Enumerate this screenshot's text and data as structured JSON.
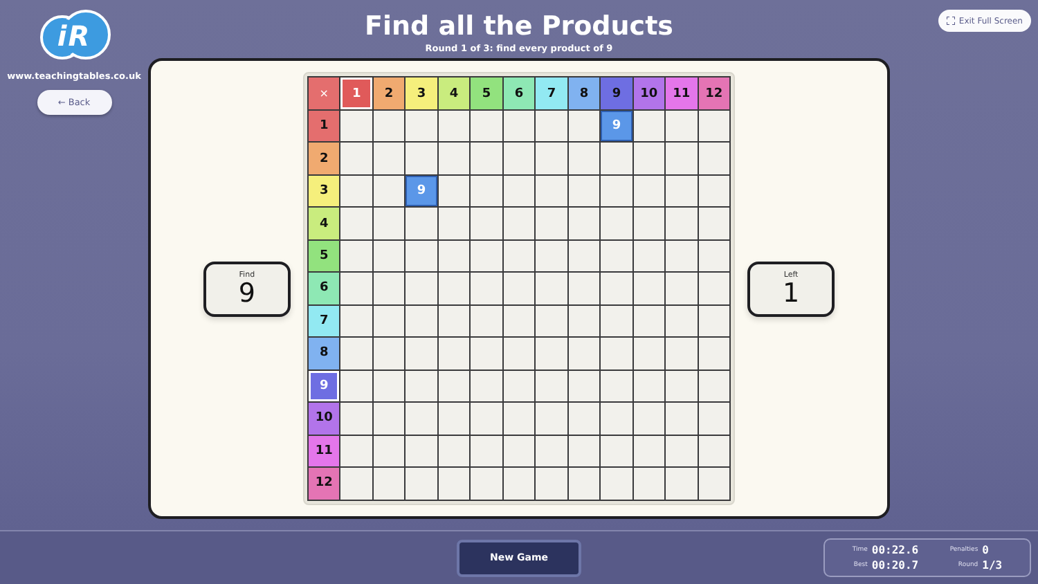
{
  "logo": {
    "text": "iR",
    "site": "www.teachingtables.co.uk"
  },
  "back_button": "← Back",
  "title": "Find all the Products",
  "subtitle": "Round 1 of 3: find every product of 9",
  "exit_button": "Exit Full Screen",
  "find": {
    "label": "Find",
    "value": "9"
  },
  "left": {
    "label": "Left",
    "value": "1"
  },
  "grid": {
    "corner": "×",
    "columns": [
      {
        "label": "1",
        "color": "#e05a5a",
        "selected": true
      },
      {
        "label": "2",
        "color": "#f0aa70",
        "selected": false
      },
      {
        "label": "3",
        "color": "#f5ef7c",
        "selected": false
      },
      {
        "label": "4",
        "color": "#c9ec7e",
        "selected": false
      },
      {
        "label": "5",
        "color": "#92e27e",
        "selected": false
      },
      {
        "label": "6",
        "color": "#8ee8b4",
        "selected": false
      },
      {
        "label": "7",
        "color": "#92e9f2",
        "selected": false
      },
      {
        "label": "8",
        "color": "#80b2f0",
        "selected": false
      },
      {
        "label": "9",
        "color": "#6e6ee2",
        "selected": false
      },
      {
        "label": "10",
        "color": "#b274ea",
        "selected": false
      },
      {
        "label": "11",
        "color": "#e476ea",
        "selected": false
      },
      {
        "label": "12",
        "color": "#e474b4",
        "selected": false
      }
    ],
    "rows": [
      {
        "label": "1",
        "color": "#e46e6e",
        "selected": false,
        "cells": [
          {
            "found": false
          },
          {
            "found": false
          },
          {
            "found": false
          },
          {
            "found": false
          },
          {
            "found": false
          },
          {
            "found": false
          },
          {
            "found": false
          },
          {
            "found": false
          },
          {
            "found": true,
            "value": "9"
          },
          {
            "found": false
          },
          {
            "found": false
          },
          {
            "found": false
          }
        ]
      },
      {
        "label": "2",
        "color": "#f0aa70",
        "selected": false,
        "cells": [
          {
            "found": false
          },
          {
            "found": false
          },
          {
            "found": false
          },
          {
            "found": false
          },
          {
            "found": false
          },
          {
            "found": false
          },
          {
            "found": false
          },
          {
            "found": false
          },
          {
            "found": false
          },
          {
            "found": false
          },
          {
            "found": false
          },
          {
            "found": false
          }
        ]
      },
      {
        "label": "3",
        "color": "#f5ef7c",
        "selected": false,
        "cells": [
          {
            "found": false
          },
          {
            "found": false
          },
          {
            "found": true,
            "value": "9"
          },
          {
            "found": false
          },
          {
            "found": false
          },
          {
            "found": false
          },
          {
            "found": false
          },
          {
            "found": false
          },
          {
            "found": false
          },
          {
            "found": false
          },
          {
            "found": false
          },
          {
            "found": false
          }
        ]
      },
      {
        "label": "4",
        "color": "#c9ec7e",
        "selected": false,
        "cells": [
          {
            "found": false
          },
          {
            "found": false
          },
          {
            "found": false
          },
          {
            "found": false
          },
          {
            "found": false
          },
          {
            "found": false
          },
          {
            "found": false
          },
          {
            "found": false
          },
          {
            "found": false
          },
          {
            "found": false
          },
          {
            "found": false
          },
          {
            "found": false
          }
        ]
      },
      {
        "label": "5",
        "color": "#92e27e",
        "selected": false,
        "cells": [
          {
            "found": false
          },
          {
            "found": false
          },
          {
            "found": false
          },
          {
            "found": false
          },
          {
            "found": false
          },
          {
            "found": false
          },
          {
            "found": false
          },
          {
            "found": false
          },
          {
            "found": false
          },
          {
            "found": false
          },
          {
            "found": false
          },
          {
            "found": false
          }
        ]
      },
      {
        "label": "6",
        "color": "#8ee8b4",
        "selected": false,
        "cells": [
          {
            "found": false
          },
          {
            "found": false
          },
          {
            "found": false
          },
          {
            "found": false
          },
          {
            "found": false
          },
          {
            "found": false
          },
          {
            "found": false
          },
          {
            "found": false
          },
          {
            "found": false
          },
          {
            "found": false
          },
          {
            "found": false
          },
          {
            "found": false
          }
        ]
      },
      {
        "label": "7",
        "color": "#92e9f2",
        "selected": false,
        "cells": [
          {
            "found": false
          },
          {
            "found": false
          },
          {
            "found": false
          },
          {
            "found": false
          },
          {
            "found": false
          },
          {
            "found": false
          },
          {
            "found": false
          },
          {
            "found": false
          },
          {
            "found": false
          },
          {
            "found": false
          },
          {
            "found": false
          },
          {
            "found": false
          }
        ]
      },
      {
        "label": "8",
        "color": "#80b2f0",
        "selected": false,
        "cells": [
          {
            "found": false
          },
          {
            "found": false
          },
          {
            "found": false
          },
          {
            "found": false
          },
          {
            "found": false
          },
          {
            "found": false
          },
          {
            "found": false
          },
          {
            "found": false
          },
          {
            "found": false
          },
          {
            "found": false
          },
          {
            "found": false
          },
          {
            "found": false
          }
        ]
      },
      {
        "label": "9",
        "color": "#6e6ee2",
        "selected": true,
        "cells": [
          {
            "found": false
          },
          {
            "found": false
          },
          {
            "found": false
          },
          {
            "found": false
          },
          {
            "found": false
          },
          {
            "found": false
          },
          {
            "found": false
          },
          {
            "found": false
          },
          {
            "found": false
          },
          {
            "found": false
          },
          {
            "found": false
          },
          {
            "found": false
          }
        ]
      },
      {
        "label": "10",
        "color": "#b274ea",
        "selected": false,
        "cells": [
          {
            "found": false
          },
          {
            "found": false
          },
          {
            "found": false
          },
          {
            "found": false
          },
          {
            "found": false
          },
          {
            "found": false
          },
          {
            "found": false
          },
          {
            "found": false
          },
          {
            "found": false
          },
          {
            "found": false
          },
          {
            "found": false
          },
          {
            "found": false
          }
        ]
      },
      {
        "label": "11",
        "color": "#e476ea",
        "selected": false,
        "cells": [
          {
            "found": false
          },
          {
            "found": false
          },
          {
            "found": false
          },
          {
            "found": false
          },
          {
            "found": false
          },
          {
            "found": false
          },
          {
            "found": false
          },
          {
            "found": false
          },
          {
            "found": false
          },
          {
            "found": false
          },
          {
            "found": false
          },
          {
            "found": false
          }
        ]
      },
      {
        "label": "12",
        "color": "#e474b4",
        "selected": false,
        "cells": [
          {
            "found": false
          },
          {
            "found": false
          },
          {
            "found": false
          },
          {
            "found": false
          },
          {
            "found": false
          },
          {
            "found": false
          },
          {
            "found": false
          },
          {
            "found": false
          },
          {
            "found": false
          },
          {
            "found": false
          },
          {
            "found": false
          },
          {
            "found": false
          }
        ]
      }
    ]
  },
  "new_game_button": "New Game",
  "stats": [
    {
      "label": "Time",
      "value": "00:22.6"
    },
    {
      "label": "Penalties",
      "value": "0"
    },
    {
      "label": "Best",
      "value": "00:20.7"
    },
    {
      "label": "Round",
      "value": "1/3"
    }
  ]
}
